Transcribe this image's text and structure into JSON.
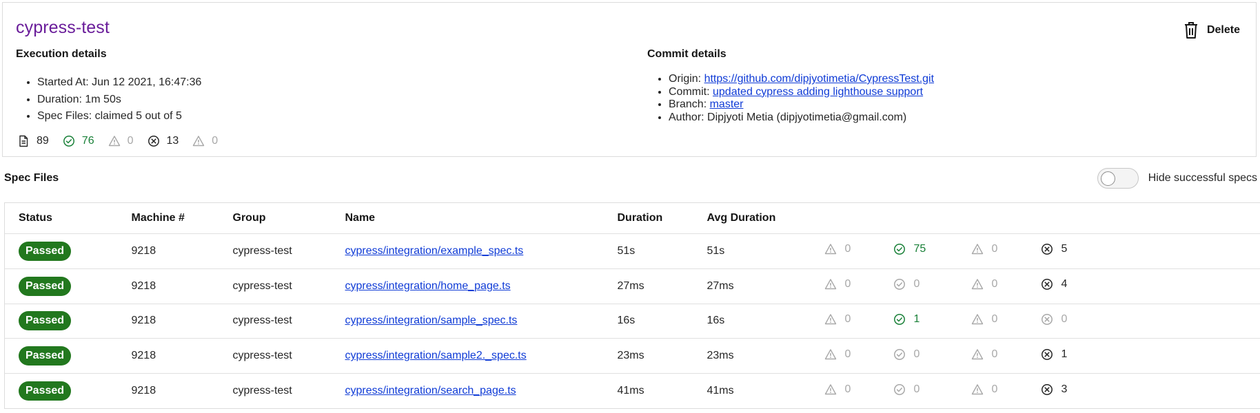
{
  "run": {
    "title": "cypress-test",
    "delete_label": "Delete",
    "execution_details": {
      "heading": "Execution details",
      "items": [
        "Started At: Jun 12 2021, 16:47:36",
        "Duration: 1m 50s",
        "Spec Files: claimed 5 out of 5"
      ]
    },
    "commit_details": {
      "heading": "Commit details",
      "origin_label": "Origin: ",
      "origin_link": "https://github.com/dipjyotimetia/CypressTest.git",
      "commit_label": "Commit: ",
      "commit_link": "updated cypress adding lighthouse support",
      "branch_label": "Branch: ",
      "branch_link": "master",
      "author": "Author: Dipjyoti Metia (dipjyotimetia@gmail.com)"
    },
    "stats": {
      "tests": "89",
      "passes": "76",
      "pending": "0",
      "failures": "13",
      "skipped": "0"
    }
  },
  "specs": {
    "heading": "Spec Files",
    "toggle_label": "Hide successful specs",
    "toggle_on": false,
    "columns": [
      "Status",
      "Machine #",
      "Group",
      "Name",
      "Duration",
      "Avg Duration"
    ],
    "rows": [
      {
        "status": "Passed",
        "machine": "9218",
        "group": "cypress-test",
        "name": "cypress/integration/example_spec.ts",
        "duration": "51s",
        "avg": "51s",
        "skipped": "0",
        "passes": "75",
        "pending": "0",
        "failures": "5"
      },
      {
        "status": "Passed",
        "machine": "9218",
        "group": "cypress-test",
        "name": "cypress/integration/home_page.ts",
        "duration": "27ms",
        "avg": "27ms",
        "skipped": "0",
        "passes": "0",
        "pending": "0",
        "failures": "4"
      },
      {
        "status": "Passed",
        "machine": "9218",
        "group": "cypress-test",
        "name": "cypress/integration/sample_spec.ts",
        "duration": "16s",
        "avg": "16s",
        "skipped": "0",
        "passes": "1",
        "pending": "0",
        "failures": "0"
      },
      {
        "status": "Passed",
        "machine": "9218",
        "group": "cypress-test",
        "name": "cypress/integration/sample2._spec.ts",
        "duration": "23ms",
        "avg": "23ms",
        "skipped": "0",
        "passes": "0",
        "pending": "0",
        "failures": "1"
      },
      {
        "status": "Passed",
        "machine": "9218",
        "group": "cypress-test",
        "name": "cypress/integration/search_page.ts",
        "duration": "41ms",
        "avg": "41ms",
        "skipped": "0",
        "passes": "0",
        "pending": "0",
        "failures": "3"
      }
    ]
  },
  "colors": {
    "title": "#6a1d9a",
    "link": "#0f3bd6",
    "passed_badge": "#22781e",
    "pass_green": "#198038",
    "muted_grey": "#a8a8a8"
  },
  "icons": {
    "delete": "trash-icon",
    "tests": "document-icon",
    "passes": "check-circle-icon",
    "pending": "warning-triangle-icon",
    "failures": "x-circle-icon",
    "skipped": "warning-triangle-icon"
  }
}
